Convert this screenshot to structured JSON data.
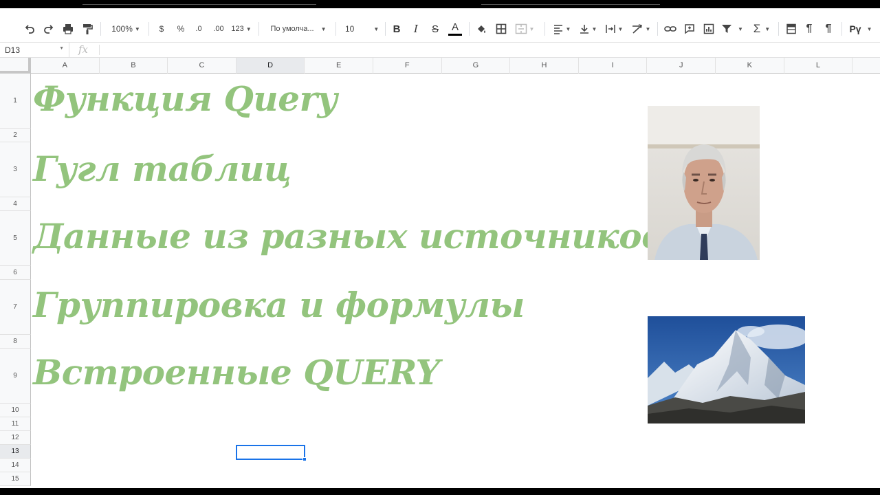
{
  "toolbar": {
    "zoom": "100%",
    "currency": "$",
    "percent": "%",
    "decimal_decrease": ".0",
    "decimal_increase": ".00",
    "number_format": "123",
    "font_name": "По умолча...",
    "font_size": "10",
    "bold": "B",
    "italic": "I",
    "strike": "S",
    "text_color": "A",
    "input_lang": "Рү"
  },
  "formula_bar": {
    "cell_ref": "D13",
    "fx_label": "fx",
    "content": ""
  },
  "columns": [
    "A",
    "B",
    "C",
    "D",
    "E",
    "F",
    "G",
    "H",
    "I",
    "J",
    "K",
    "L"
  ],
  "selected_column": "D",
  "rows": [
    "1",
    "2",
    "3",
    "4",
    "5",
    "6",
    "7",
    "8",
    "9",
    "10",
    "11",
    "12",
    "13",
    "14",
    "15"
  ],
  "selected_row": "13",
  "sheet_text": {
    "line1": "Функция Query",
    "line2": "Гугл таблиц",
    "line3": "Данные из  разных источников",
    "line4": "Группировка и формулы",
    "line5": "Встроенные QUERY"
  },
  "images": {
    "portrait": "portrait-photo",
    "mountain": "mountain-photo"
  },
  "colors": {
    "headline": "#93c47d",
    "selection": "#1a73e8"
  }
}
